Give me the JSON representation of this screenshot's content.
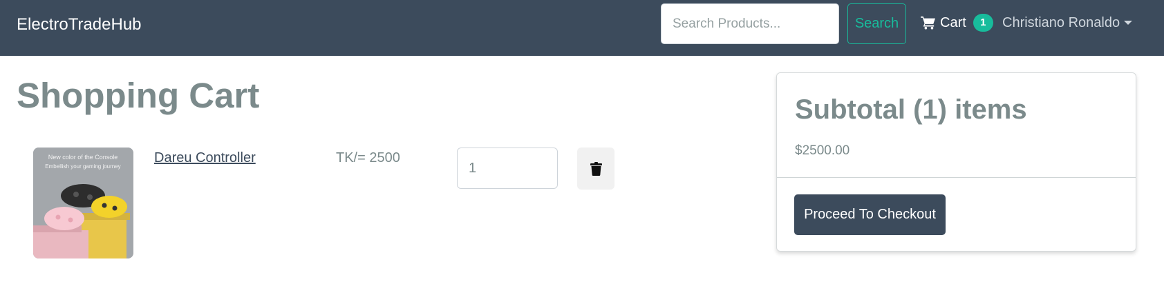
{
  "navbar": {
    "brand": "ElectroTradeHub",
    "search": {
      "placeholder": "Search Products...",
      "value": ""
    },
    "search_button": "Search",
    "cart": {
      "icon": "shopping-cart-icon",
      "label": "Cart",
      "count": "1"
    },
    "user": {
      "name": "Christiano Ronaldo"
    }
  },
  "main": {
    "title": "Shopping Cart",
    "items": [
      {
        "name": "Dareu Controller",
        "price": "TK/= 2500",
        "quantity": "1",
        "image_text_top": "New color of the Console",
        "image_text_sub": "Embellish your gaming journey",
        "delete_icon": "trash-icon"
      }
    ]
  },
  "summary": {
    "title": "Subtotal (1) items",
    "amount": "$2500.00",
    "checkout_button": "Proceed To Checkout"
  },
  "colors": {
    "navbar_bg": "#3c4b5c",
    "accent": "#18bc9c",
    "muted_text": "#7b8a8b"
  }
}
